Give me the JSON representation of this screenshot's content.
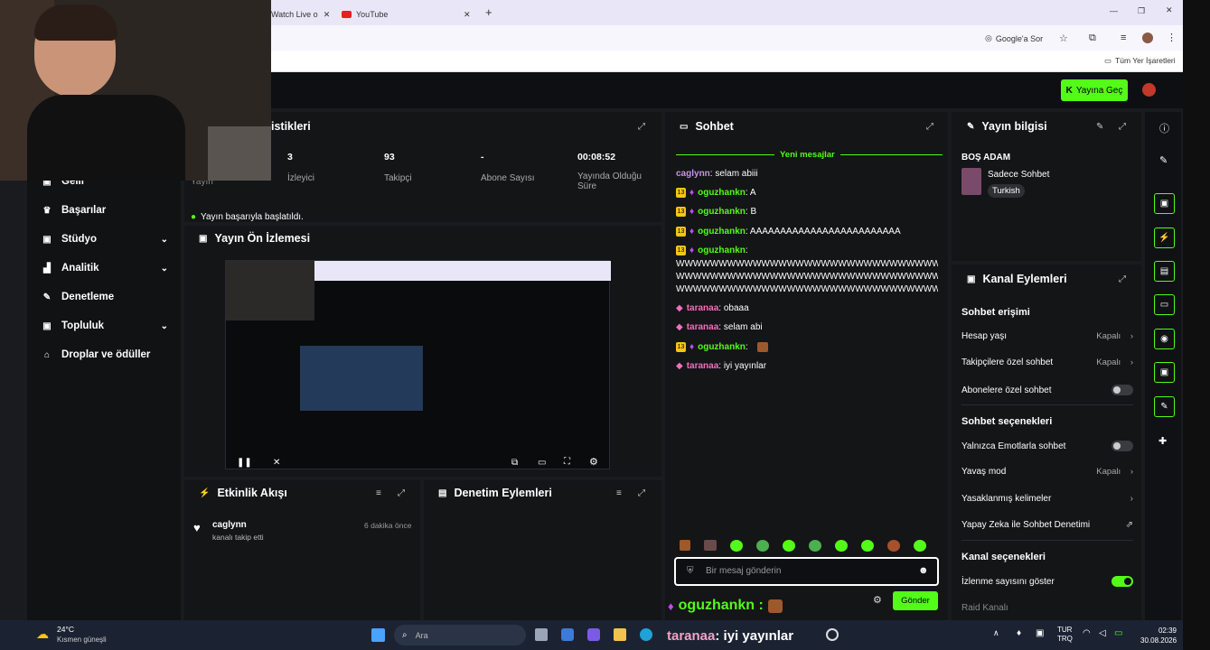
{
  "browser": {
    "tabs": [
      {
        "label": "Watch Live o"
      },
      {
        "label": "YouTube"
      }
    ],
    "google_lens": "Google'a Sor",
    "bookmarks_label": "Tüm Yer İşaretleri"
  },
  "header": {
    "go_live": "Yayına Geç"
  },
  "sidebar": {
    "items": [
      {
        "label": "Gelir",
        "icon": "money-icon"
      },
      {
        "label": "Başarılar",
        "icon": "trophy-icon"
      },
      {
        "label": "Stüdyo",
        "icon": "studio-icon",
        "chevron": true
      },
      {
        "label": "Analitik",
        "icon": "chart-icon",
        "chevron": true
      },
      {
        "label": "Denetleme",
        "icon": "wrench-icon"
      },
      {
        "label": "Topluluk",
        "icon": "community-icon",
        "chevron": true
      },
      {
        "label": "Droplar ve ödüller",
        "icon": "gift-icon"
      }
    ]
  },
  "stats": {
    "title": "istikleri",
    "partial_label": "Yayın",
    "items": [
      {
        "value": "3",
        "label": "İzleyici"
      },
      {
        "value": "93",
        "label": "Takipçi"
      },
      {
        "value": "-",
        "label": "Abone Sayısı"
      },
      {
        "value": "00:08:52",
        "label": "Yayında Olduğu Süre"
      }
    ],
    "status": "Yayın başarıyla başlatıldı."
  },
  "preview": {
    "title": "Yayın Ön İzlemesi"
  },
  "activity": {
    "title": "Etkinlik Akışı",
    "items": [
      {
        "user": "caglynn",
        "desc": "kanalı takip etti",
        "time": "6 dakika önce"
      }
    ]
  },
  "moderation": {
    "title": "Denetim Eylemleri"
  },
  "chat": {
    "title": "Sohbet",
    "new_messages": "Yeni mesajlar",
    "messages": [
      {
        "user": "caglynn",
        "text": ": selam abiii"
      },
      {
        "user": "oguzhankn",
        "text": ": A"
      },
      {
        "user": "oguzhankn",
        "text": ": B"
      },
      {
        "user": "oguzhankn",
        "text": ": AAAAAAAAAAAAAAAAAAAAAAAAA"
      },
      {
        "user": "oguzhankn",
        "text": ":"
      },
      {
        "user": "taranaa",
        "text": ": obaaa"
      },
      {
        "user": "taranaa",
        "text": ": selam abi"
      },
      {
        "user": "oguzhankn",
        "text": ":"
      },
      {
        "user": "taranaa",
        "text": ": iyi yayınlar"
      }
    ],
    "wline": "WWWWWWWWWWWWWWWWWWWWWWWWWWWWWWWWW",
    "input_placeholder": "Bir mesaj gönderin",
    "send": "Gönder",
    "overlay_user": "oguzhankn :",
    "overlay_tarana": "taranaa",
    "overlay_text": ": iyi yayınlar"
  },
  "stream_info": {
    "title": "Yayın bilgisi",
    "stream_title": "BOŞ ADAM",
    "category": "Sadece Sohbet",
    "language": "Turkish"
  },
  "channel_actions": {
    "title": "Kanal Eylemleri",
    "chat_access": "Sohbet erişimi",
    "account_age": "Hesap yaşı",
    "account_age_value": "Kapalı",
    "followers_only": "Takipçilere özel sohbet",
    "followers_only_value": "Kapalı",
    "subs_only": "Abonelere özel sohbet",
    "chat_options": "Sohbet seçenekleri",
    "emote_only": "Yalnızca Emotlarla sohbet",
    "slow_mode": "Yavaş mod",
    "slow_mode_value": "Kapalı",
    "banned_words": "Yasaklanmış kelimeler",
    "ai_moderation": "Yapay Zeka ile Sohbet Denetimi",
    "channel_options": "Kanal seçenekleri",
    "show_viewers": "İzlenme sayısını göster",
    "raid": "Raid Kanalı"
  },
  "taskbar": {
    "temp": "24°C",
    "weather": "Kısmen güneşli",
    "search": "Ara",
    "lang1": "TUR",
    "lang2": "TRQ",
    "time": "02:39",
    "date": "30.08.2026"
  }
}
